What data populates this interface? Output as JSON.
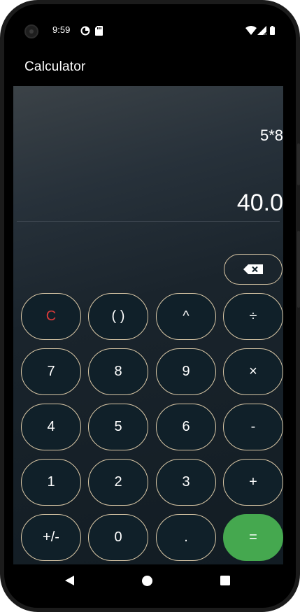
{
  "status_bar": {
    "time": "9:59",
    "icons": [
      "camera-icon",
      "data-saver-icon",
      "sd-card-icon",
      "wifi-icon",
      "signal-icon",
      "battery-icon"
    ]
  },
  "app_bar": {
    "title": "Calculator"
  },
  "display": {
    "expression": "5*8",
    "result": "40.0"
  },
  "colors": {
    "key_border": "#d9c7a6",
    "key_background": "#102029",
    "clear_text": "#d93a3a",
    "equals_background": "#45a84f"
  },
  "keypad": {
    "backspace_icon": "backspace-icon",
    "row1": {
      "clear": "C",
      "parentheses": "( )",
      "power": "^",
      "divide": "÷"
    },
    "row2": {
      "seven": "7",
      "eight": "8",
      "nine": "9",
      "multiply": "×"
    },
    "row3": {
      "four": "4",
      "five": "5",
      "six": "6",
      "subtract": "-"
    },
    "row4": {
      "one": "1",
      "two": "2",
      "three": "3",
      "add": "+"
    },
    "row5": {
      "negate": "+/-",
      "zero": "0",
      "decimal": ".",
      "equals": "="
    }
  },
  "nav_bar": {
    "icons": [
      "back-icon",
      "home-icon",
      "recents-icon"
    ]
  }
}
